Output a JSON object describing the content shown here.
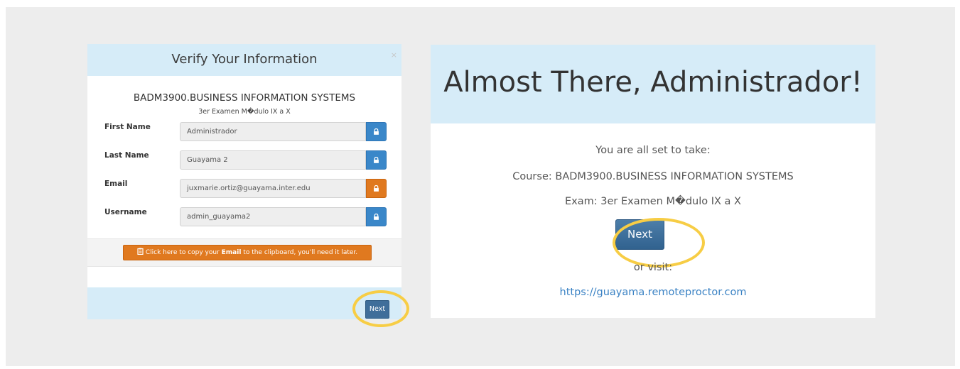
{
  "modal": {
    "title": "Verify Your Information",
    "close": "×",
    "course": "BADM3900.BUSINESS INFORMATION SYSTEMS",
    "exam": "3er Examen M�dulo IX a X",
    "fields": [
      {
        "label": "First Name",
        "value": "Administrador",
        "lock_color": "blue"
      },
      {
        "label": "Last Name",
        "value": "Guayama 2",
        "lock_color": "blue"
      },
      {
        "label": "Email",
        "value": "juxmarie.ortiz@guayama.inter.edu",
        "lock_color": "orange"
      },
      {
        "label": "Username",
        "value": "admin_guayama2",
        "lock_color": "blue"
      }
    ],
    "copy_button": {
      "icon": "clipboard-icon",
      "prefix": "Click here to copy your ",
      "emphasis": "Email",
      "suffix": " to the clipboard, you'll need it later."
    },
    "next_label": "Next"
  },
  "panel": {
    "title": "Almost There, Administrador!",
    "ready_text": "You are all set to take:",
    "course_text": "Course: BADM3900.BUSINESS INFORMATION SYSTEMS",
    "exam_text": "Exam: 3er Examen M�dulo IX a X",
    "next_label": "Next",
    "or_visit": "or visit:",
    "link": "https://guayama.remoteproctor.com"
  },
  "colors": {
    "header_bg": "#d6ecf8",
    "lock_blue": "#3a87c9",
    "lock_orange": "#e0791f",
    "highlight_ring": "#f7cd45",
    "next_button": "#3f6e9a",
    "link": "#3a82c4"
  }
}
